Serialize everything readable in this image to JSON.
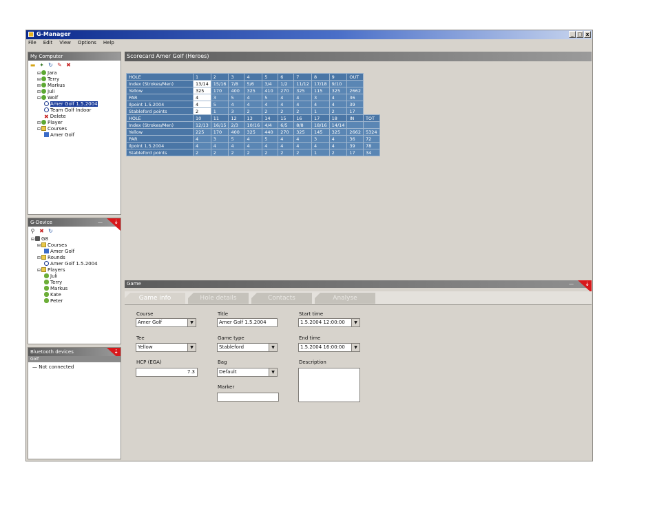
{
  "window": {
    "title": "G-Manager",
    "min": "_",
    "max": "□",
    "close": "x"
  },
  "menu": [
    "File",
    "Edit",
    "View",
    "Options",
    "Help"
  ],
  "my_computer": {
    "title": "My Computer",
    "items": [
      {
        "label": "Jara",
        "indent": 1,
        "icon": "node"
      },
      {
        "label": "Terry",
        "indent": 1,
        "icon": "node"
      },
      {
        "label": "Markus",
        "indent": 1,
        "icon": "node"
      },
      {
        "label": "Juli",
        "indent": 1,
        "icon": "node"
      },
      {
        "label": "Wolf",
        "indent": 1,
        "icon": "node"
      },
      {
        "label": "Amer Golf 1.5.2004",
        "indent": 2,
        "icon": "round",
        "selected": true
      },
      {
        "label": "Team Golf Indoor",
        "indent": 2,
        "icon": "round"
      },
      {
        "label": "Delete",
        "indent": 2,
        "icon": "red"
      },
      {
        "label": "Player",
        "indent": 1,
        "icon": "node"
      },
      {
        "label": "Courses",
        "indent": 1,
        "icon": "folder"
      },
      {
        "label": "Amer Golf",
        "indent": 2,
        "icon": "course"
      }
    ]
  },
  "gdevice": {
    "title": "G-Device",
    "items": [
      {
        "label": "G8",
        "indent": 0,
        "icon": "pc"
      },
      {
        "label": "Courses",
        "indent": 1,
        "icon": "folder"
      },
      {
        "label": "Amer Golf",
        "indent": 2,
        "icon": "course"
      },
      {
        "label": "Rounds",
        "indent": 1,
        "icon": "folder"
      },
      {
        "label": "Amer Golf 1.5.2004",
        "indent": 2,
        "icon": "round"
      },
      {
        "label": "Players",
        "indent": 1,
        "icon": "folder"
      },
      {
        "label": "Juli",
        "indent": 2,
        "icon": "player"
      },
      {
        "label": "Terry",
        "indent": 2,
        "icon": "player"
      },
      {
        "label": "Markus",
        "indent": 2,
        "icon": "player"
      },
      {
        "label": "Kate",
        "indent": 2,
        "icon": "player"
      },
      {
        "label": "Peter",
        "indent": 2,
        "icon": "player"
      }
    ]
  },
  "bluetooth": {
    "title": "Bluetooth devices",
    "subtitle": "Golf",
    "item": "Not connected"
  },
  "scorecard": {
    "title": "Scorecard Amer Golf (Heroes)",
    "rows": [
      {
        "type": "hdr",
        "cells": [
          "HOLE",
          "1",
          "2",
          "3",
          "4",
          "5",
          "6",
          "7",
          "8",
          "9",
          "OUT"
        ]
      },
      {
        "type": "row",
        "cells": [
          "Index (Strokes/Men)",
          "13/14",
          "15/16",
          "7/8",
          "5/6",
          "3/4",
          "1/2",
          "11/12",
          "17/18",
          "9/10",
          ""
        ]
      },
      {
        "type": "row",
        "cells": [
          "Yellow",
          "325",
          "170",
          "400",
          "325",
          "410",
          "270",
          "325",
          "115",
          "325",
          "2662"
        ]
      },
      {
        "type": "row",
        "cells": [
          "PAR",
          "4",
          "3",
          "5",
          "4",
          "5",
          "4",
          "4",
          "3",
          "4",
          "36"
        ]
      },
      {
        "type": "row",
        "cells": [
          "Ilpoint 1.5.2004",
          "4",
          "5",
          "4",
          "4",
          "4",
          "4",
          "4",
          "4",
          "4",
          "39"
        ]
      },
      {
        "type": "row",
        "cells": [
          "Stableford points",
          "2",
          "1",
          "3",
          "2",
          "2",
          "2",
          "2",
          "1",
          "2",
          "17"
        ]
      },
      {
        "type": "hdr",
        "cells": [
          "HOLE",
          "10",
          "11",
          "12",
          "13",
          "14",
          "15",
          "16",
          "17",
          "18",
          "IN",
          "TOT"
        ]
      },
      {
        "type": "row",
        "cells": [
          "Index (Strokes/Men)",
          "12/13",
          "16/15",
          "2/3",
          "10/16",
          "4/4",
          "6/5",
          "8/8",
          "18/16",
          "14/14",
          "",
          ""
        ]
      },
      {
        "type": "row",
        "cells": [
          "Yellow",
          "225",
          "170",
          "400",
          "325",
          "440",
          "270",
          "325",
          "145",
          "325",
          "2662",
          "5324"
        ]
      },
      {
        "type": "row",
        "cells": [
          "PAR",
          "4",
          "3",
          "5",
          "4",
          "5",
          "4",
          "4",
          "3",
          "4",
          "36",
          "72"
        ]
      },
      {
        "type": "row",
        "cells": [
          "Ilpoint 1.5.2004",
          "4",
          "4",
          "4",
          "4",
          "4",
          "4",
          "4",
          "4",
          "4",
          "39",
          "78"
        ]
      },
      {
        "type": "row",
        "cells": [
          "Stableford points",
          "2",
          "2",
          "2",
          "2",
          "2",
          "2",
          "2",
          "1",
          "2",
          "17",
          "34"
        ]
      }
    ]
  },
  "game": {
    "title": "Game",
    "tabs": [
      "Game info",
      "Hole details",
      "Contacts",
      "Analyse"
    ],
    "fields": {
      "course_label": "Course",
      "course_value": "Amer Golf",
      "tee_label": "Tee",
      "tee_value": "Yellow",
      "hcp_label": "HCP (EGA)",
      "hcp_value": "7.3",
      "title_label": "Title",
      "title_value": "Amer Golf 1.5.2004",
      "game_type_label": "Game type",
      "game_type_value": "Stableford",
      "bag_label": "Bag",
      "bag_value": "Default",
      "marker_label": "Marker",
      "marker_value": "",
      "start_label": "Start time",
      "start_value": "1.5.2004 12:00:00",
      "end_label": "End time",
      "end_value": "1.5.2004 16:00:00",
      "desc_label": "Description"
    }
  }
}
